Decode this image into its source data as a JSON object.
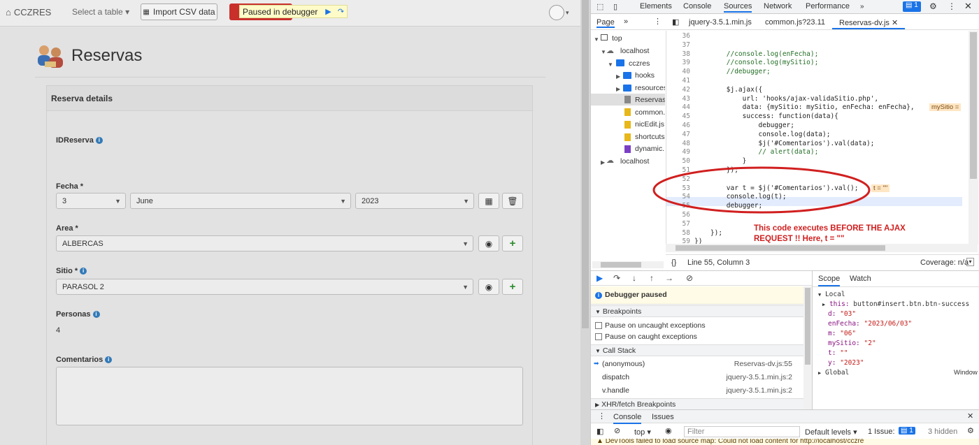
{
  "app": {
    "brand": "CCZRES",
    "select_table": "Select a table",
    "import_csv": "Import CSV data",
    "paused_banner": "Paused in debugger"
  },
  "page": {
    "title": "Reservas",
    "panel_title": "Reserva details",
    "fields": {
      "id_label": "IDReserva",
      "fecha_label": "Fecha",
      "fecha_day": "3",
      "fecha_month": "June",
      "fecha_year": "2023",
      "area_label": "Area",
      "area_value": "ALBERCAS",
      "sitio_label": "Sitio",
      "sitio_value": "PARASOL 2",
      "personas_label": "Personas",
      "personas_value": "4",
      "comentarios_label": "Comentarios",
      "required_mark": "*"
    }
  },
  "devtools": {
    "tabs": [
      "Elements",
      "Console",
      "Sources",
      "Network",
      "Performance"
    ],
    "active_tab": "Sources",
    "badge": "1",
    "nav": {
      "page": "Page",
      "more": "»"
    },
    "files": [
      "jquery-3.5.1.min.js",
      "common.js?23.11",
      "Reservas-dv.js"
    ],
    "tree": {
      "top": "top",
      "localhost1": "localhost",
      "cczres": "cczres",
      "hooks": "hooks",
      "resources": "resources",
      "reservas": "Reservas_",
      "common": "common.",
      "nicedit": "nicEdit.js",
      "shortcuts": "shortcuts",
      "dynamic": "dynamic.",
      "localhost2": "localhost"
    },
    "code_lines": [
      {
        "n": "36",
        "t": ""
      },
      {
        "n": "37",
        "t": ""
      },
      {
        "n": "38",
        "t": "        //console.log(enFecha);"
      },
      {
        "n": "39",
        "t": "        //console.log(mySitio);"
      },
      {
        "n": "40",
        "t": "        //debugger;"
      },
      {
        "n": "41",
        "t": ""
      },
      {
        "n": "42",
        "t": "        $j.ajax({"
      },
      {
        "n": "43",
        "t": "            url: 'hooks/ajax-validaSitio.php',"
      },
      {
        "n": "44",
        "t": "            data: {mySitio: mySitio, enFecha: enFecha},"
      },
      {
        "n": "45",
        "t": "            success: function(data){"
      },
      {
        "n": "46",
        "t": "                debugger;"
      },
      {
        "n": "47",
        "t": "                console.log(data);"
      },
      {
        "n": "48",
        "t": "                $j('#Comentarios').val(data);"
      },
      {
        "n": "49",
        "t": "                // alert(data);"
      },
      {
        "n": "50",
        "t": "            }"
      },
      {
        "n": "51",
        "t": "        });"
      },
      {
        "n": "52",
        "t": ""
      },
      {
        "n": "53",
        "t": "        var t = $j('#Comentarios').val();"
      },
      {
        "n": "54",
        "t": "        console.log(t);"
      },
      {
        "n": "55",
        "t": "        debugger;"
      },
      {
        "n": "56",
        "t": ""
      },
      {
        "n": "57",
        "t": ""
      },
      {
        "n": "58",
        "t": "    });"
      },
      {
        "n": "59",
        "t": "})"
      }
    ],
    "inline_44": "mySitio =",
    "inline_53": "t = \"\"",
    "annotation_line1": "This code executes BEFORE THE AJAX",
    "annotation_line2": "REQUEST !!  Here, t = \"\"",
    "status_position": "Line 55, Column 3",
    "coverage": "Coverage: n/a",
    "scope_tab": "Scope",
    "watch_tab": "Watch",
    "debugger_paused": "Debugger paused",
    "breakpoints": "Breakpoints",
    "pause_uncaught": "Pause on uncaught exceptions",
    "pause_caught": "Pause on caught exceptions",
    "call_stack": "Call Stack",
    "stack": [
      {
        "fn": "(anonymous)",
        "loc": "Reservas-dv.js:55"
      },
      {
        "fn": "dispatch",
        "loc": "jquery-3.5.1.min.js:2"
      },
      {
        "fn": "v.handle",
        "loc": "jquery-3.5.1.min.js:2"
      }
    ],
    "xhr_breakpoints": "XHR/fetch Breakpoints",
    "scope": {
      "local": "Local",
      "this_key": "this:",
      "this_val": "button#insert.btn.btn-success",
      "vars": [
        {
          "k": "d:",
          "v": "\"03\""
        },
        {
          "k": "enFecha:",
          "v": "\"2023/06/03\""
        },
        {
          "k": "m:",
          "v": "\"06\""
        },
        {
          "k": "mySitio:",
          "v": "\"2\""
        },
        {
          "k": "t:",
          "v": "\"\""
        },
        {
          "k": "y:",
          "v": "\"2023\""
        }
      ],
      "global": "Global",
      "global_val": "Window"
    },
    "drawer": {
      "console": "Console",
      "issues": "Issues",
      "context": "top",
      "filter": "Filter",
      "levels": "Default levels",
      "issues_count": "1 Issue:",
      "issues_badge": "1",
      "hidden": "3 hidden",
      "msg": "DevTools failed to load source map: Could not load content for http://localhost/cczre"
    }
  }
}
